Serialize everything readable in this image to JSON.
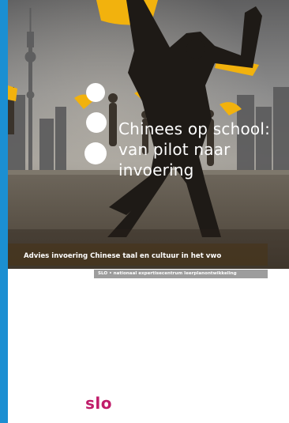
{
  "cover": {
    "title_lines": [
      "Chinees op school:",
      "van pilot naar",
      "invoering"
    ],
    "subtitle": "Advies invoering Chinese taal en cultuur in het vwo",
    "publisher": "SLO • nationaal expertisecentrum leerplanontwikkeling",
    "logo": "slo",
    "photo_description_icon": "tai-chi-fan-dancer-photo"
  },
  "colors": {
    "side_bar": "#1b8fd2",
    "logo": "#c01c6a",
    "publisher_band": "#9d9d9d",
    "fans": "#f2b20d"
  }
}
